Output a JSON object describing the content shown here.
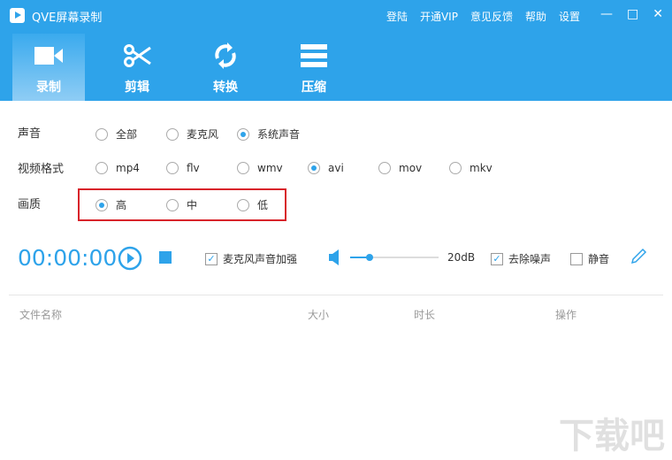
{
  "app": {
    "title": "QVE屏幕录制"
  },
  "topmenu": [
    "登陆",
    "开通VIP",
    "意见反馈",
    "帮助",
    "设置"
  ],
  "tabs": [
    {
      "label": "录制",
      "icon": "video-camera-icon"
    },
    {
      "label": "剪辑",
      "icon": "scissors-icon"
    },
    {
      "label": "转换",
      "icon": "refresh-icon"
    },
    {
      "label": "压缩",
      "icon": "compress-icon"
    }
  ],
  "sound": {
    "label": "声音",
    "options": [
      "全部",
      "麦克风",
      "系统声音"
    ],
    "selected": "系统声音"
  },
  "format": {
    "label": "视频格式",
    "options": [
      "mp4",
      "flv",
      "wmv",
      "avi",
      "mov",
      "mkv"
    ],
    "selected": "avi"
  },
  "quality": {
    "label": "画质",
    "options": [
      "高",
      "中",
      "低"
    ],
    "selected": "高"
  },
  "controls": {
    "timer": "00:00:00",
    "mic_boost": {
      "label": "麦克风声音加强",
      "checked": true
    },
    "volume_percent": 22,
    "volume_label": "20dB",
    "denoise": {
      "label": "去除噪声",
      "checked": true
    },
    "mute": {
      "label": "静音",
      "checked": false
    }
  },
  "table": {
    "headers": [
      "文件名称",
      "大小",
      "时长",
      "操作"
    ]
  },
  "watermark": "下载吧",
  "colors": {
    "accent": "#2ea3ea",
    "highlight": "#d8232a"
  }
}
